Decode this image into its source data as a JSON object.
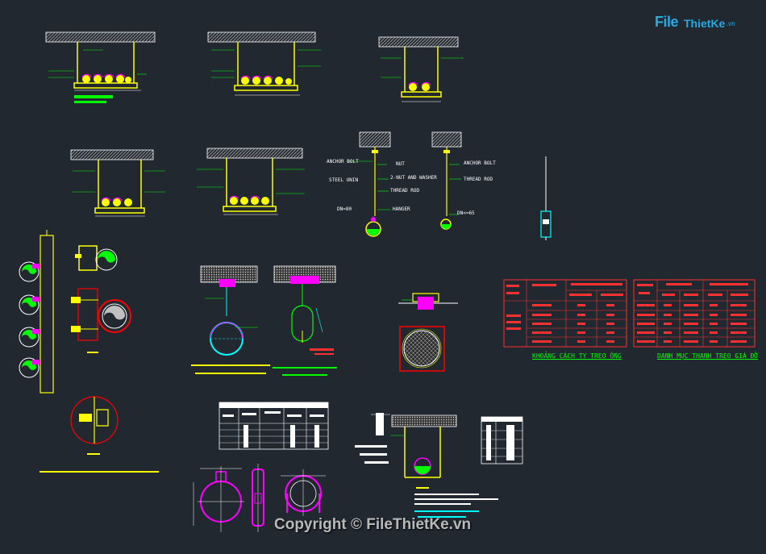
{
  "watermark": {
    "logo_file": "File",
    "logo_rest": "ThietKe",
    "logo_tld": ".vn",
    "copyright": "Copyright © FileThietKe.vn"
  },
  "hanger_labels": {
    "anchor_bolt": "ANCHOR BOLT",
    "nut": "NUT",
    "steel_unin": "STEEL UNIN",
    "nut_washer": "2-NUT AND WASHER",
    "thread_rod": "THREAD ROD",
    "hanger": "HANGER",
    "dn_left": "DN=80",
    "anchor_bolt_2": "ANCHOR BOLT",
    "thread_rod_2": "THREAD ROD",
    "dn_right": "DN<=65"
  },
  "table1": {
    "title": "KHOẢNG CÁCH TY TREO ỐNG"
  },
  "table2": {
    "title": "DANH MỤC THANH TREO GIÁ ĐỠ"
  },
  "colors": {
    "background": "#212830",
    "green": "#00ff00",
    "yellow": "#ffff00",
    "magenta": "#ff00ff",
    "cyan": "#00ffff",
    "red": "#ff0000",
    "white": "#ffffff"
  }
}
